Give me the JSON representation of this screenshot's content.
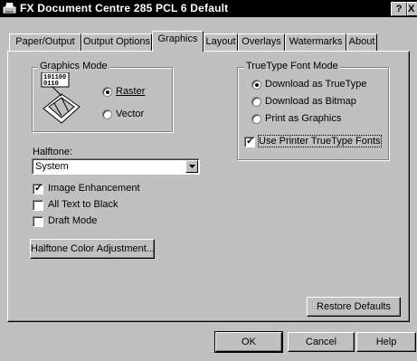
{
  "window": {
    "title": "FX Document Centre 285 PCL 6 Default",
    "help_glyph": "?",
    "close_glyph": "X"
  },
  "tabs": [
    {
      "label": "Paper/Output"
    },
    {
      "label": "Output Options"
    },
    {
      "label": "Graphics",
      "active": true
    },
    {
      "label": "Layout"
    },
    {
      "label": "Overlays"
    },
    {
      "label": "Watermarks"
    },
    {
      "label": "About"
    }
  ],
  "graphics_mode": {
    "title": "Graphics Mode",
    "bitmap_text_1": "101100",
    "bitmap_text_2": "0110",
    "options": [
      {
        "label": "Raster",
        "selected": true
      },
      {
        "label": "Vector",
        "selected": false
      }
    ]
  },
  "truetype": {
    "title": "TrueType Font Mode",
    "options": [
      {
        "label": "Download as TrueType",
        "selected": true
      },
      {
        "label": "Download as Bitmap",
        "selected": false
      },
      {
        "label": "Print as Graphics",
        "selected": false
      }
    ],
    "use_printer_fonts": {
      "label": "Use Printer TrueType Fonts",
      "checked": true
    }
  },
  "halftone": {
    "label": "Halftone:",
    "value": "System"
  },
  "options": [
    {
      "label": "Image Enhancement",
      "checked": true
    },
    {
      "label": "All Text to Black",
      "checked": false
    },
    {
      "label": "Draft Mode",
      "checked": false
    }
  ],
  "buttons": {
    "halftone_color": "Halftone Color Adjustment...",
    "restore_defaults": "Restore Defaults",
    "ok": "OK",
    "cancel": "Cancel",
    "help": "Help"
  }
}
